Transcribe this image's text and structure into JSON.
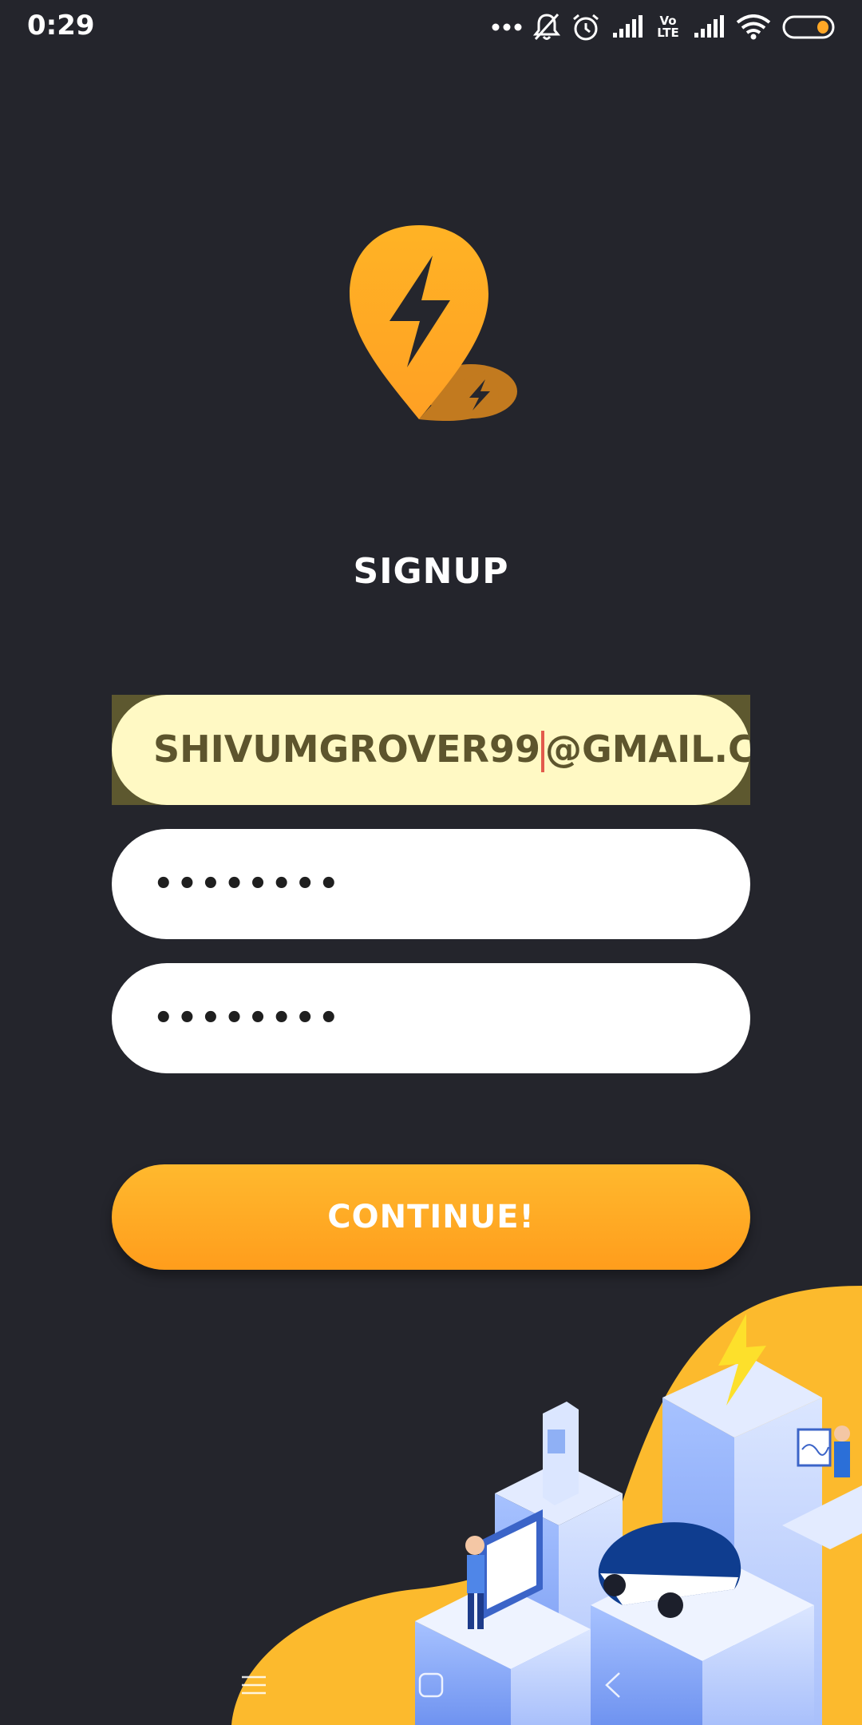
{
  "status_bar": {
    "time": "0:29",
    "icons": [
      "more-dots-icon",
      "bell-off-icon",
      "alarm-icon",
      "signal-icon",
      "volte-icon",
      "signal-icon",
      "wifi-icon",
      "battery-icon"
    ],
    "volte_label": "Vo LTE"
  },
  "logo": {
    "icon": "lightning-pin-icon",
    "accent": "#FFA726"
  },
  "title": "SIGNUP",
  "form": {
    "email": {
      "value_before_caret": "SHIVUMGROVER99",
      "value_after_caret": "@GMAIL.CON"
    },
    "password": {
      "mask": "••••••••"
    },
    "confirm_password": {
      "mask": "••••••••"
    },
    "continue_label": "CONTINUE!"
  },
  "colors": {
    "background": "#24252C",
    "accent": "#FFA726",
    "autofill": "#FFF9C4"
  },
  "nav_bar": {
    "icons": [
      "menu-icon",
      "home-square-icon",
      "back-chevron-icon"
    ]
  }
}
